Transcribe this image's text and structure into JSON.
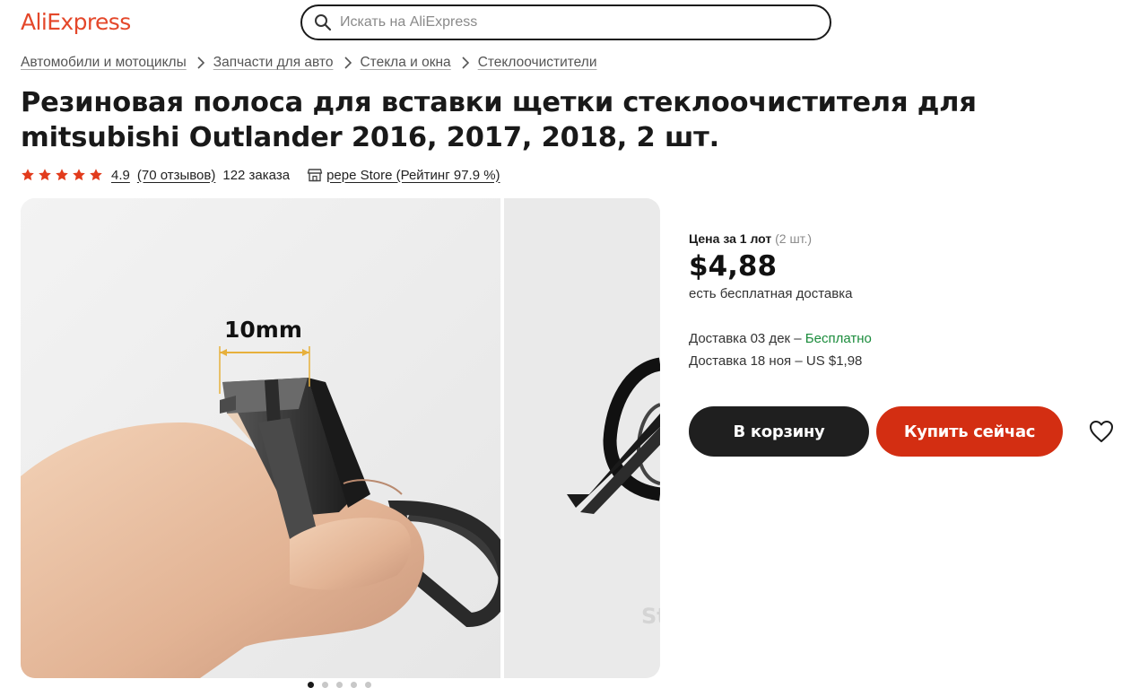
{
  "header": {
    "logo": "AliExpress",
    "search_placeholder": "Искать на AliExpress"
  },
  "breadcrumbs": [
    "Автомобили и мотоциклы",
    "Запчасти для авто",
    "Стекла и окна",
    "Стеклоочистители"
  ],
  "product": {
    "title": "Резиновая полоса для вставки щетки стеклоочистителя для mitsubishi Outlander 2016, 2017, 2018, 2 шт.",
    "rating": "4.9",
    "stars": 5,
    "reviews": "(70 отзывов)",
    "orders": "122 заказа",
    "store": "pepe Store (Рейтинг 97.9 %)"
  },
  "gallery": {
    "dimension_label": "10mm",
    "watermark": "St",
    "dots_count": 5,
    "active_dot": 0
  },
  "pricing": {
    "label": "Цена за 1 лот",
    "lot_size": "(2 шт.)",
    "price": "$4,88",
    "free_shipping": "есть бесплатная доставка",
    "delivery_1_prefix": "Доставка 03 дек – ",
    "delivery_1_value": "Бесплатно",
    "delivery_2": "Доставка 18 ноя – US $1,98"
  },
  "actions": {
    "add_to_cart": "В корзину",
    "buy_now": "Купить сейчас"
  },
  "colors": {
    "brand": "#e4472a",
    "buy_button": "#d32e12",
    "cart_button": "#1f1f1f",
    "free_delivery": "#1b8c3c",
    "stars": "#e23b1c"
  }
}
